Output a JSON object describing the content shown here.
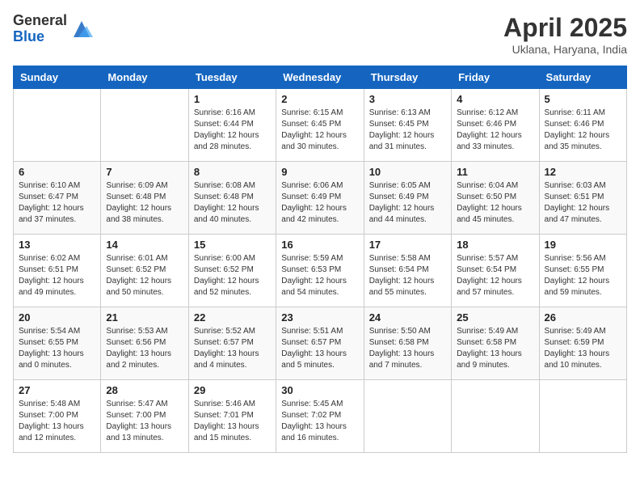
{
  "header": {
    "logo_general": "General",
    "logo_blue": "Blue",
    "month_title": "April 2025",
    "subtitle": "Uklana, Haryana, India"
  },
  "weekdays": [
    "Sunday",
    "Monday",
    "Tuesday",
    "Wednesday",
    "Thursday",
    "Friday",
    "Saturday"
  ],
  "weeks": [
    [
      {
        "day": "",
        "info": ""
      },
      {
        "day": "",
        "info": ""
      },
      {
        "day": "1",
        "info": "Sunrise: 6:16 AM\nSunset: 6:44 PM\nDaylight: 12 hours and 28 minutes."
      },
      {
        "day": "2",
        "info": "Sunrise: 6:15 AM\nSunset: 6:45 PM\nDaylight: 12 hours and 30 minutes."
      },
      {
        "day": "3",
        "info": "Sunrise: 6:13 AM\nSunset: 6:45 PM\nDaylight: 12 hours and 31 minutes."
      },
      {
        "day": "4",
        "info": "Sunrise: 6:12 AM\nSunset: 6:46 PM\nDaylight: 12 hours and 33 minutes."
      },
      {
        "day": "5",
        "info": "Sunrise: 6:11 AM\nSunset: 6:46 PM\nDaylight: 12 hours and 35 minutes."
      }
    ],
    [
      {
        "day": "6",
        "info": "Sunrise: 6:10 AM\nSunset: 6:47 PM\nDaylight: 12 hours and 37 minutes."
      },
      {
        "day": "7",
        "info": "Sunrise: 6:09 AM\nSunset: 6:48 PM\nDaylight: 12 hours and 38 minutes."
      },
      {
        "day": "8",
        "info": "Sunrise: 6:08 AM\nSunset: 6:48 PM\nDaylight: 12 hours and 40 minutes."
      },
      {
        "day": "9",
        "info": "Sunrise: 6:06 AM\nSunset: 6:49 PM\nDaylight: 12 hours and 42 minutes."
      },
      {
        "day": "10",
        "info": "Sunrise: 6:05 AM\nSunset: 6:49 PM\nDaylight: 12 hours and 44 minutes."
      },
      {
        "day": "11",
        "info": "Sunrise: 6:04 AM\nSunset: 6:50 PM\nDaylight: 12 hours and 45 minutes."
      },
      {
        "day": "12",
        "info": "Sunrise: 6:03 AM\nSunset: 6:51 PM\nDaylight: 12 hours and 47 minutes."
      }
    ],
    [
      {
        "day": "13",
        "info": "Sunrise: 6:02 AM\nSunset: 6:51 PM\nDaylight: 12 hours and 49 minutes."
      },
      {
        "day": "14",
        "info": "Sunrise: 6:01 AM\nSunset: 6:52 PM\nDaylight: 12 hours and 50 minutes."
      },
      {
        "day": "15",
        "info": "Sunrise: 6:00 AM\nSunset: 6:52 PM\nDaylight: 12 hours and 52 minutes."
      },
      {
        "day": "16",
        "info": "Sunrise: 5:59 AM\nSunset: 6:53 PM\nDaylight: 12 hours and 54 minutes."
      },
      {
        "day": "17",
        "info": "Sunrise: 5:58 AM\nSunset: 6:54 PM\nDaylight: 12 hours and 55 minutes."
      },
      {
        "day": "18",
        "info": "Sunrise: 5:57 AM\nSunset: 6:54 PM\nDaylight: 12 hours and 57 minutes."
      },
      {
        "day": "19",
        "info": "Sunrise: 5:56 AM\nSunset: 6:55 PM\nDaylight: 12 hours and 59 minutes."
      }
    ],
    [
      {
        "day": "20",
        "info": "Sunrise: 5:54 AM\nSunset: 6:55 PM\nDaylight: 13 hours and 0 minutes."
      },
      {
        "day": "21",
        "info": "Sunrise: 5:53 AM\nSunset: 6:56 PM\nDaylight: 13 hours and 2 minutes."
      },
      {
        "day": "22",
        "info": "Sunrise: 5:52 AM\nSunset: 6:57 PM\nDaylight: 13 hours and 4 minutes."
      },
      {
        "day": "23",
        "info": "Sunrise: 5:51 AM\nSunset: 6:57 PM\nDaylight: 13 hours and 5 minutes."
      },
      {
        "day": "24",
        "info": "Sunrise: 5:50 AM\nSunset: 6:58 PM\nDaylight: 13 hours and 7 minutes."
      },
      {
        "day": "25",
        "info": "Sunrise: 5:49 AM\nSunset: 6:58 PM\nDaylight: 13 hours and 9 minutes."
      },
      {
        "day": "26",
        "info": "Sunrise: 5:49 AM\nSunset: 6:59 PM\nDaylight: 13 hours and 10 minutes."
      }
    ],
    [
      {
        "day": "27",
        "info": "Sunrise: 5:48 AM\nSunset: 7:00 PM\nDaylight: 13 hours and 12 minutes."
      },
      {
        "day": "28",
        "info": "Sunrise: 5:47 AM\nSunset: 7:00 PM\nDaylight: 13 hours and 13 minutes."
      },
      {
        "day": "29",
        "info": "Sunrise: 5:46 AM\nSunset: 7:01 PM\nDaylight: 13 hours and 15 minutes."
      },
      {
        "day": "30",
        "info": "Sunrise: 5:45 AM\nSunset: 7:02 PM\nDaylight: 13 hours and 16 minutes."
      },
      {
        "day": "",
        "info": ""
      },
      {
        "day": "",
        "info": ""
      },
      {
        "day": "",
        "info": ""
      }
    ]
  ]
}
